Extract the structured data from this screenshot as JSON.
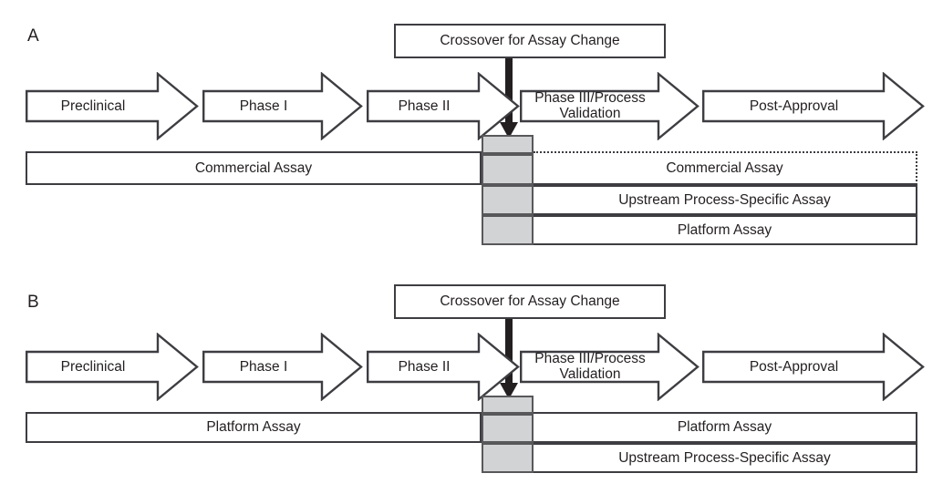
{
  "figure": {
    "title": "Assay lifecycle crossover diagram",
    "background": "#ffffff",
    "line_color": "#3d3d42",
    "gray_fill": "#d2d3d5",
    "gray_border": "#58585b",
    "text_color": "#231f20"
  },
  "panels": [
    {
      "id": "A",
      "label": "A",
      "crossover": {
        "label": "Crossover for Assay Change"
      },
      "phases": [
        {
          "label": "Preclinical"
        },
        {
          "label": "Phase I"
        },
        {
          "label": "Phase II"
        },
        {
          "label": "Phase III/Process\nValidation",
          "line1": "Phase III/Process",
          "line2": "Validation"
        },
        {
          "label": "Post-Approval"
        }
      ],
      "bars_left": [
        {
          "label": "Commercial Assay",
          "style": "solid"
        }
      ],
      "bars_right": [
        {
          "label": "Commercial Assay",
          "style": "dotted-open"
        },
        {
          "label": "Upstream Process-Specific Assay",
          "style": "open-left"
        },
        {
          "label": "Platform Assay",
          "style": "open-left"
        }
      ],
      "gray_segments": 4
    },
    {
      "id": "B",
      "label": "B",
      "crossover": {
        "label": "Crossover for Assay Change"
      },
      "phases": [
        {
          "label": "Preclinical"
        },
        {
          "label": "Phase I"
        },
        {
          "label": "Phase II"
        },
        {
          "label": "Phase III/Process\nValidation",
          "line1": "Phase III/Process",
          "line2": "Validation"
        },
        {
          "label": "Post-Approval"
        }
      ],
      "bars_left": [
        {
          "label": "Platform Assay",
          "style": "solid"
        }
      ],
      "bars_right": [
        {
          "label": "Platform Assay",
          "style": "open-left"
        },
        {
          "label": "Upstream Process-Specific Assay",
          "style": "open-left"
        }
      ],
      "gray_segments": 3
    }
  ]
}
